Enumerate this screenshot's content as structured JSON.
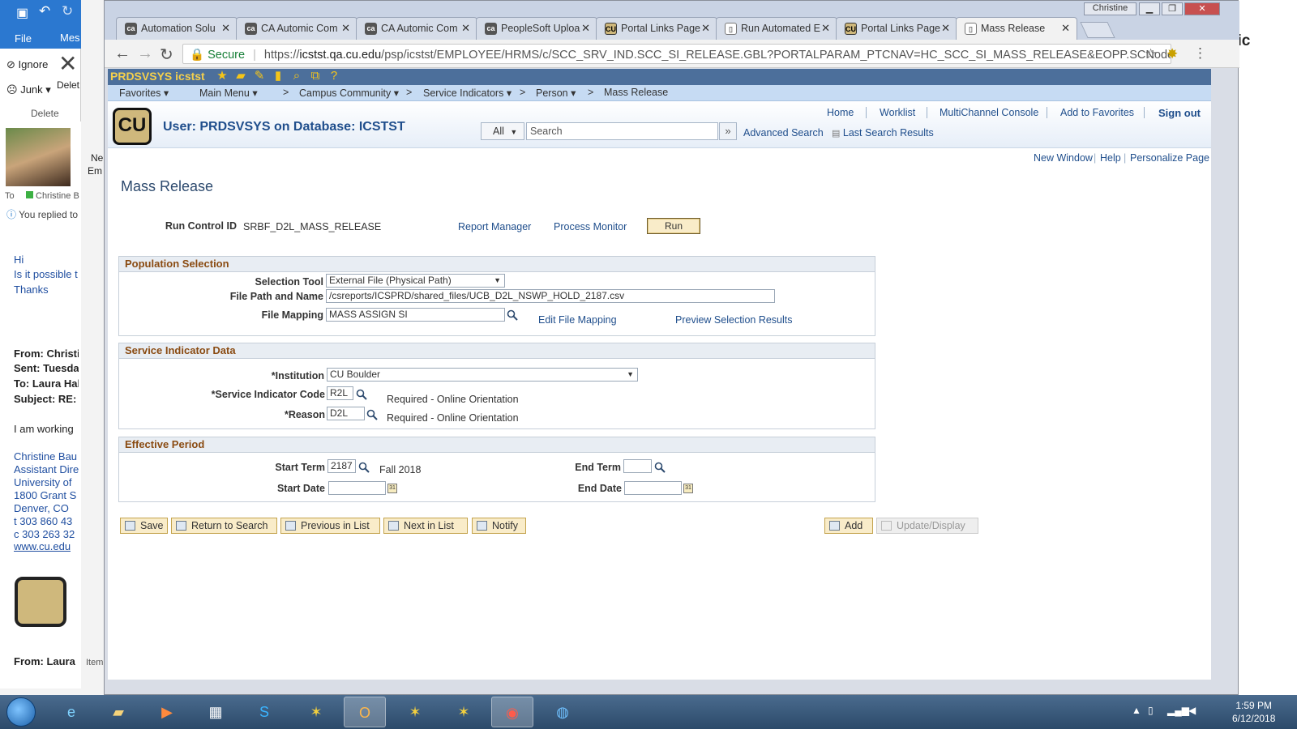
{
  "outlook": {
    "file_label": "File",
    "tab_partial": "Mes",
    "ignore_label": "Ignore",
    "junk_label": "Junk",
    "delete_partial": "Delet",
    "delete_group": "Delete",
    "new_partial": "Ne",
    "em_partial": "Em",
    "to_label": "To",
    "to_name": "Christine B",
    "replied": "You replied to",
    "body_hi": "Hi",
    "body_q": "Is it possible t",
    "body_thanks": "Thanks",
    "from1": "From: Christi",
    "sent1": "Sent: Tuesda",
    "to1": "To: Laura Hal",
    "subject1": "Subject: RE: H",
    "working": "I am working",
    "sig_name": "Christine Bau",
    "sig_title": "Assistant Dire",
    "sig_univ": "University of",
    "sig_addr": "1800 Grant S",
    "sig_city": "Denver, CO",
    "sig_t": "t  303 860 43",
    "sig_c": "c  303 263 32",
    "sig_web": "www.cu.edu",
    "from2": "From: Laura H",
    "items_partial": "Item",
    "right_partial": "omic"
  },
  "browser": {
    "window_user": "Christine",
    "tabs": [
      {
        "label": "Automation Solu",
        "icon": "ca"
      },
      {
        "label": "CA Automic Com",
        "icon": "ca"
      },
      {
        "label": "CA Automic Com",
        "icon": "ca"
      },
      {
        "label": "PeopleSoft Uploa",
        "icon": "ca"
      },
      {
        "label": "Portal Links Page",
        "icon": "cu"
      },
      {
        "label": "Run Automated E",
        "icon": "doc"
      },
      {
        "label": "Portal Links Page",
        "icon": "cu"
      },
      {
        "label": "Mass Release",
        "icon": "doc"
      }
    ],
    "secure_label": "Secure",
    "url_scheme": "https://",
    "url_host": "icstst.qa.cu.edu",
    "url_path": "/psp/icstst/EMPLOYEE/HRMS/c/SCC_SRV_IND.SCC_SI_RELEASE.GBL?PORTALPARAM_PTCNAV=HC_SCC_SI_MASS_RELEASE&EOPP.SCNode=HRMS&EOPP.SC..."
  },
  "ps": {
    "env_title": "PRDSVSYS icstst",
    "menu": {
      "favorites": "Favorites",
      "main_menu": "Main Menu",
      "sep": ">",
      "campus": "Campus Community",
      "service_indicators": "Service Indicators",
      "person": "Person",
      "mass_release": "Mass Release"
    },
    "logo_text": "CU",
    "user_line": "User: PRDSVSYS on Database: ICSTST",
    "header_links": {
      "home": "Home",
      "worklist": "Worklist",
      "multichannel": "MultiChannel Console",
      "add_fav": "Add to Favorites",
      "sign_out": "Sign out"
    },
    "search": {
      "scope": "All",
      "placeholder": "Search",
      "go": "»",
      "advanced": "Advanced Search",
      "last_results": "Last Search Results"
    },
    "top_links": {
      "new_window": "New Window",
      "help": "Help",
      "personalize": "Personalize Page"
    },
    "page_title": "Mass Release",
    "run_control_label": "Run Control ID",
    "run_control_value": "SRBF_D2L_MASS_RELEASE",
    "report_manager": "Report Manager",
    "process_monitor": "Process Monitor",
    "run_button": "Run",
    "population": {
      "title": "Population Selection",
      "selection_tool_label": "Selection Tool",
      "selection_tool_value": "External File (Physical Path)",
      "file_path_label": "File Path and Name",
      "file_path_value": "/csreports/ICSPRD/shared_files/UCB_D2L_NSWP_HOLD_2187.csv",
      "file_mapping_label": "File Mapping",
      "file_mapping_value": "MASS ASSIGN SI",
      "edit_mapping": "Edit File Mapping",
      "preview": "Preview Selection Results"
    },
    "service": {
      "title": "Service Indicator Data",
      "institution_label": "*Institution",
      "institution_value": "CU Boulder",
      "code_label": "*Service Indicator Code",
      "code_value": "R2L",
      "code_desc": "Required - Online Orientation",
      "reason_label": "*Reason",
      "reason_value": "D2L",
      "reason_desc": "Required - Online Orientation"
    },
    "effective": {
      "title": "Effective Period",
      "start_term_label": "Start Term",
      "start_term_value": "2187",
      "start_term_desc": "Fall 2018",
      "end_term_label": "End Term",
      "end_term_value": "",
      "start_date_label": "Start Date",
      "start_date_value": "",
      "end_date_label": "End Date",
      "end_date_value": ""
    },
    "buttons": {
      "save": "Save",
      "return": "Return to Search",
      "previous": "Previous in List",
      "next": "Next in List",
      "notify": "Notify",
      "add": "Add",
      "update": "Update/Display"
    }
  },
  "taskbar": {
    "time": "1:59 PM",
    "date": "6/12/2018"
  }
}
